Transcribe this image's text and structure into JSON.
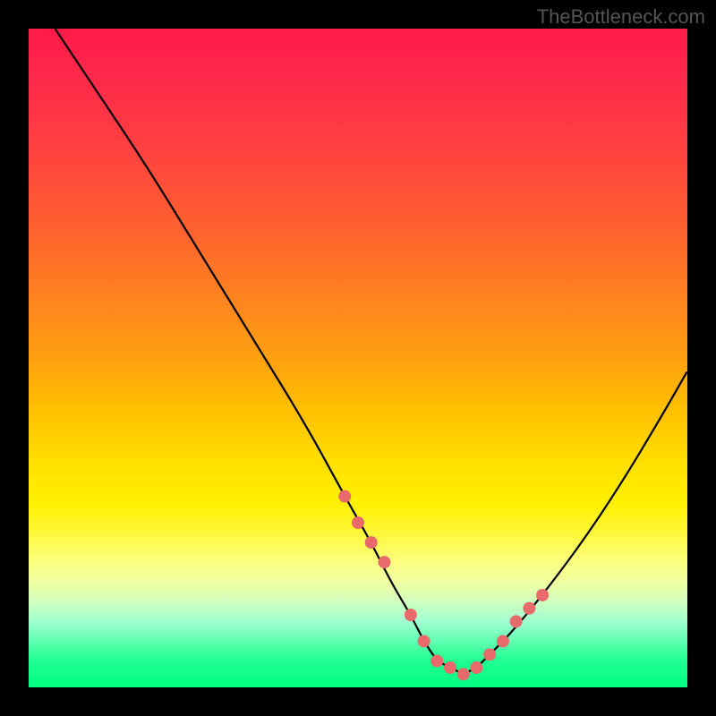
{
  "watermark": "TheBottleneck.com",
  "chart_data": {
    "type": "line",
    "title": "",
    "xlabel": "",
    "ylabel": "",
    "xlim": [
      0,
      100
    ],
    "ylim": [
      0,
      100
    ],
    "series": [
      {
        "name": "bottleneck-curve",
        "x": [
          4,
          10,
          18,
          26,
          34,
          42,
          48,
          52,
          55,
          58,
          60,
          62,
          64,
          66,
          68,
          70,
          73,
          78,
          84,
          90,
          96,
          100
        ],
        "y": [
          100,
          91,
          79,
          66,
          53,
          40,
          29,
          22,
          16,
          11,
          7,
          4,
          3,
          2,
          3,
          5,
          8,
          14,
          22,
          31,
          41,
          48
        ]
      }
    ],
    "points": {
      "name": "highlight-dots",
      "x": [
        48,
        50,
        52,
        54,
        58,
        60,
        62,
        64,
        66,
        68,
        70,
        72,
        74,
        76,
        78
      ],
      "y": [
        29,
        25,
        22,
        19,
        11,
        7,
        4,
        3,
        2,
        3,
        5,
        7,
        10,
        12,
        14
      ]
    },
    "gradient_stops": [
      {
        "pos": 0,
        "color": "#ff1a4a"
      },
      {
        "pos": 50,
        "color": "#ffc000"
      },
      {
        "pos": 80,
        "color": "#fff840"
      },
      {
        "pos": 100,
        "color": "#00ff80"
      }
    ]
  }
}
